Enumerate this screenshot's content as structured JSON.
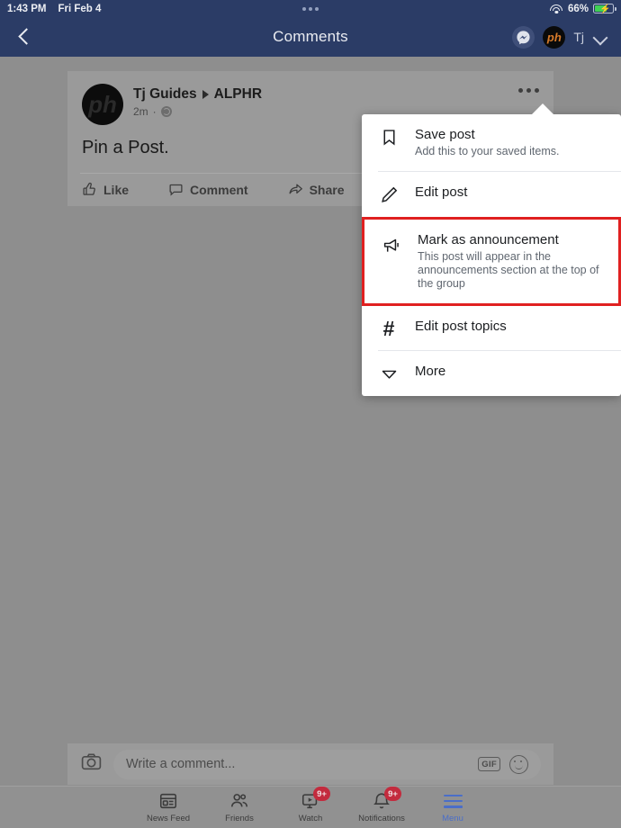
{
  "status_bar": {
    "time": "1:43 PM",
    "date": "Fri Feb 4",
    "battery_percent": "66%",
    "battery_level": 66,
    "wifi_icon": "wifi-icon",
    "charging_icon": "lightning-bolt-icon",
    "center_dots_icon": "three-dots-icon"
  },
  "navbar": {
    "back_icon": "back-chevron-icon",
    "title": "Comments",
    "messenger_icon": "messenger-icon",
    "avatar_text": "ph",
    "user_name": "Tj",
    "caret_icon": "chevron-down-icon"
  },
  "post": {
    "avatar_text": "ph",
    "author": "Tj Guides",
    "group": "ALPHR",
    "separator_icon": "triangle-right-icon",
    "time": "2m",
    "privacy_icon": "globe-icon",
    "dot": "·",
    "body": "Pin a Post.",
    "menu_icon": "three-dots-icon",
    "actions": [
      {
        "label": "Like",
        "icon": "thumbs-up-icon"
      },
      {
        "label": "Comment",
        "icon": "comment-bubble-icon"
      },
      {
        "label": "Share",
        "icon": "share-arrow-icon"
      }
    ]
  },
  "menu": {
    "highlight_color": "#e02020",
    "items": [
      {
        "title": "Save post",
        "subtitle": "Add this to your saved items.",
        "icon": "bookmark-icon",
        "highlighted": false
      },
      {
        "title": "Edit post",
        "subtitle": "",
        "icon": "pencil-icon",
        "highlighted": false
      },
      {
        "title": "Mark as announcement",
        "subtitle": "This post will appear in the announcements section at the top of the group",
        "icon": "megaphone-icon",
        "highlighted": true
      },
      {
        "title": "Edit post topics",
        "subtitle": "",
        "icon": "hash-icon",
        "highlighted": false
      },
      {
        "title": "More",
        "subtitle": "",
        "icon": "chevron-down-icon",
        "highlighted": false
      }
    ]
  },
  "composer": {
    "camera_icon": "camera-icon",
    "placeholder": "Write a comment...",
    "gif_label": "GIF",
    "emoji_icon": "smiley-icon"
  },
  "tabbar": {
    "items": [
      {
        "label": "News Feed",
        "icon": "news-feed-icon",
        "badge": "",
        "active": false
      },
      {
        "label": "Friends",
        "icon": "friends-icon",
        "badge": "",
        "active": false
      },
      {
        "label": "Watch",
        "icon": "watch-icon",
        "badge": "9+",
        "active": false
      },
      {
        "label": "Notifications",
        "icon": "bell-icon",
        "badge": "9+",
        "active": false
      },
      {
        "label": "Menu",
        "icon": "hamburger-icon",
        "badge": "",
        "active": true
      }
    ]
  }
}
